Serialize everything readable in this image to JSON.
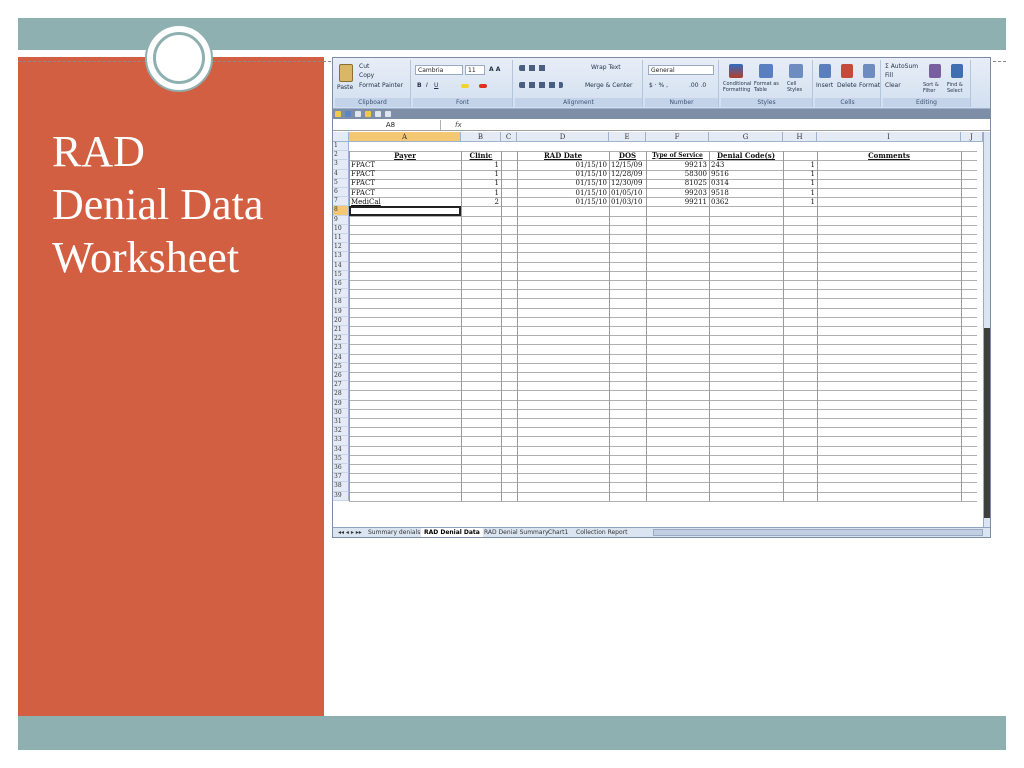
{
  "slide": {
    "title_lines": [
      "RAD",
      "Denial Data",
      "Worksheet"
    ],
    "colors": {
      "accent": "#d35f42",
      "band": "#8fb0b0"
    }
  },
  "excel": {
    "ribbon": {
      "clipboard": {
        "paste": "Paste",
        "cut": "Cut",
        "copy": "Copy",
        "format_painter": "Format Painter",
        "label": "Clipboard"
      },
      "font": {
        "name": "Cambria",
        "size": "11",
        "label": "Font"
      },
      "alignment": {
        "wrap_text": "Wrap Text",
        "merge_center": "Merge & Center",
        "label": "Alignment"
      },
      "number": {
        "format": "General",
        "label": "Number"
      },
      "styles": {
        "conditional": "Conditional Formatting",
        "format_table": "Format as Table",
        "cell_styles": "Cell Styles",
        "label": "Styles"
      },
      "cells": {
        "insert": "Insert",
        "delete": "Delete",
        "format": "Format",
        "label": "Cells"
      },
      "editing": {
        "autosum": "AutoSum",
        "fill": "Fill",
        "clear": "Clear",
        "sort_filter": "Sort & Filter",
        "find_select": "Find & Select",
        "label": "Editing"
      }
    },
    "formula_bar": {
      "name_box": "A8",
      "fx": "fx"
    },
    "columns": [
      "A",
      "B",
      "C",
      "D",
      "E",
      "F",
      "G",
      "H",
      "I",
      "J"
    ],
    "headers": [
      "Payer",
      "Clinic",
      "RAD Date",
      "DOS",
      "Type of Service",
      "Denial Code(s)",
      "Comments"
    ],
    "rows": [
      {
        "num": "3",
        "payer": "FPACT",
        "clinic": "1",
        "rad_date": "01/15/10",
        "dos": "12/15/09",
        "service": "99213",
        "denial": "243",
        "h": "1"
      },
      {
        "num": "4",
        "payer": "FPACT",
        "clinic": "1",
        "rad_date": "01/15/10",
        "dos": "12/28/09",
        "service": "58300",
        "denial": "9516",
        "h": "1"
      },
      {
        "num": "5",
        "payer": "FPACT",
        "clinic": "1",
        "rad_date": "01/15/10",
        "dos": "12/30/09",
        "service": "81025",
        "denial": "0314",
        "h": "1"
      },
      {
        "num": "6",
        "payer": "FPACT",
        "clinic": "1",
        "rad_date": "01/15/10",
        "dos": "01/05/10",
        "service": "99203",
        "denial": "9518",
        "h": "1"
      },
      {
        "num": "7",
        "payer": "MediCal",
        "clinic": "2",
        "rad_date": "01/15/10",
        "dos": "01/03/10",
        "service": "99211",
        "denial": "0362",
        "h": "1"
      }
    ],
    "row_numbers": [
      "1",
      "2",
      "3",
      "4",
      "5",
      "6",
      "7",
      "8",
      "9",
      "10",
      "11",
      "12",
      "13",
      "14",
      "15",
      "16",
      "17",
      "18",
      "19",
      "20",
      "21",
      "22",
      "23",
      "24",
      "25",
      "26",
      "27",
      "28",
      "29",
      "30",
      "31",
      "32",
      "33",
      "34",
      "35",
      "36",
      "37",
      "38",
      "39"
    ],
    "sheet_tabs": [
      "Summary denials",
      "RAD Denial Data",
      "RAD Denial Summary",
      "Chart1",
      "Collection Report"
    ],
    "active_tab": "RAD Denial Data"
  }
}
